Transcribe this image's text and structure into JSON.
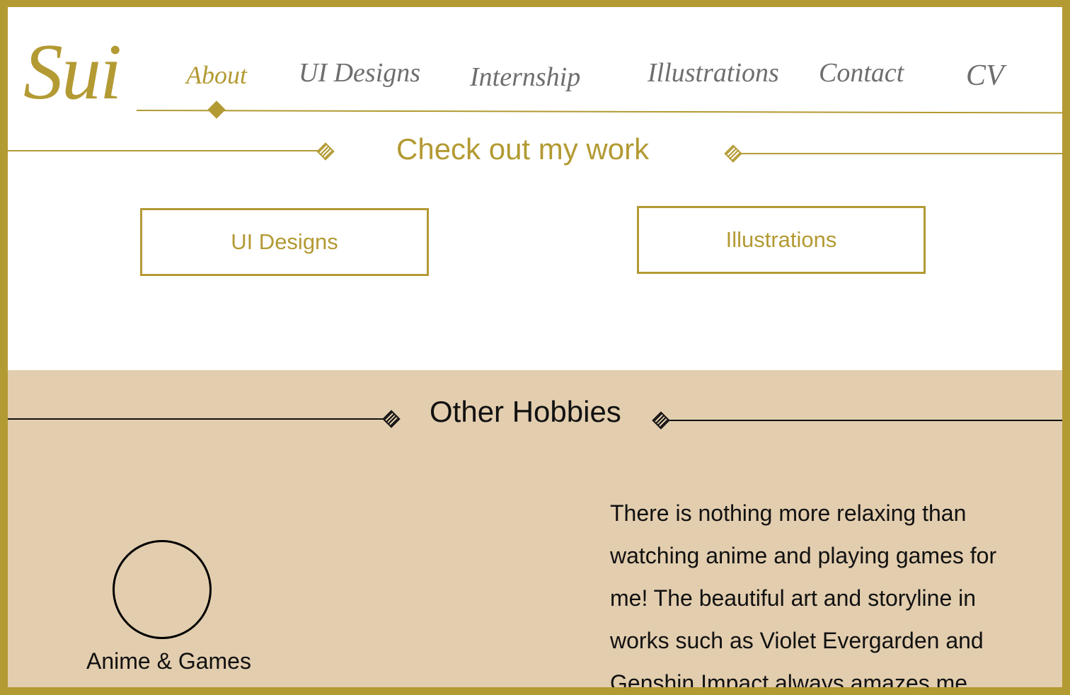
{
  "brand": {
    "logo_text": "Sui"
  },
  "nav": {
    "items": [
      {
        "label": "About",
        "active": true
      },
      {
        "label": "UI Designs",
        "active": false
      },
      {
        "label": "Internship",
        "active": false
      },
      {
        "label": "Illustrations",
        "active": false
      },
      {
        "label": "Contact",
        "active": false
      },
      {
        "label": "CV",
        "active": false
      }
    ]
  },
  "work": {
    "title": "Check out my work",
    "buttons": [
      {
        "label": "UI Designs"
      },
      {
        "label": "Illustrations"
      }
    ]
  },
  "hobbies": {
    "title": "Other Hobbies",
    "item_label": "Anime & Games",
    "description": "There is nothing more relaxing than watching anime and playing games for me! The beautiful art and storyline in works such as Violet Evergarden and Genshin Impact always amazes me."
  },
  "colors": {
    "accent": "#b39a33",
    "nav_inactive": "#6e6e6e",
    "hobbies_background": "#e2cdae",
    "background": "#ffffff"
  },
  "icons": [
    "diamond-marker-icon",
    "diamond-ornament-icon"
  ]
}
